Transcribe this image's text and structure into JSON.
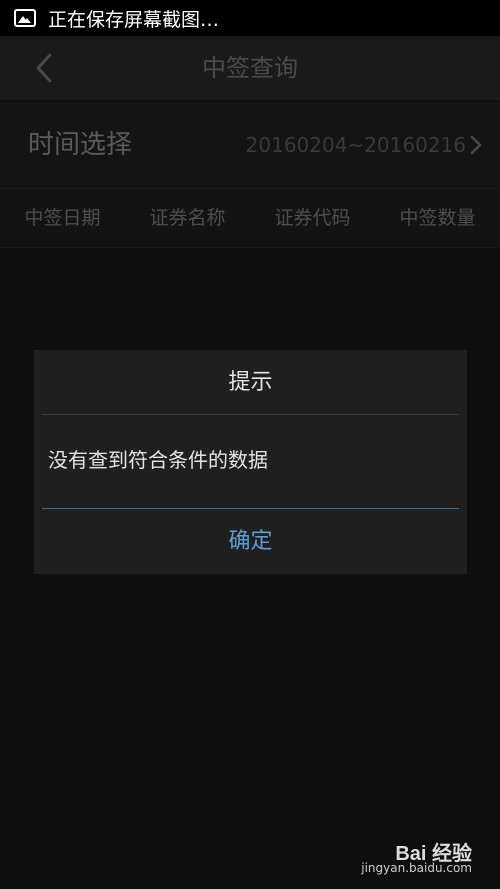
{
  "status_bar": {
    "text": "正在保存屏幕截图…",
    "icon": "image-icon"
  },
  "title_bar": {
    "title": "中签查询",
    "back_icon": "chevron-left-icon"
  },
  "time_row": {
    "label": "时间选择",
    "range": "20160204~20160216"
  },
  "table": {
    "headers": [
      "中签日期",
      "证券名称",
      "证券代码",
      "中签数量"
    ]
  },
  "dialog": {
    "title": "提示",
    "message": "没有查到符合条件的数据",
    "confirm": "确定",
    "accent_color": "#5b9fd6"
  },
  "watermark": {
    "brand": "Bai 经验",
    "domain": "jingyan.baidu.com"
  }
}
